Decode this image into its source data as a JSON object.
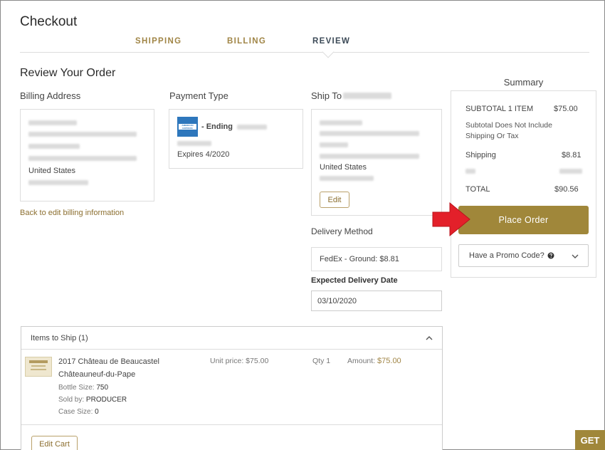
{
  "page": {
    "title": "Checkout"
  },
  "steps": [
    {
      "label": "SHIPPING"
    },
    {
      "label": "BILLING"
    },
    {
      "label": "REVIEW"
    }
  ],
  "review": {
    "heading": "Review Your Order",
    "billing": {
      "heading": "Billing Address",
      "country": "United States",
      "back_link": "Back to edit billing information"
    },
    "payment": {
      "heading": "Payment Type",
      "card_brand": "AMERICAN EXPRESS",
      "ending_label": "- Ending",
      "expires": "Expires 4/2020"
    },
    "ship_to": {
      "heading": "Ship To",
      "country": "United States",
      "edit_label": "Edit"
    },
    "delivery": {
      "heading": "Delivery Method",
      "method": "FedEx - Ground: $8.81",
      "date_heading": "Expected Delivery Date",
      "date_value": "03/10/2020"
    }
  },
  "items": {
    "header": "Items to Ship (1)",
    "rows": [
      {
        "name_line1": "2017 Château de Beaucastel",
        "name_line2": "Châteauneuf-du-Pape",
        "bottle_label": "Bottle Size:",
        "bottle_value": "750",
        "sold_label": "Sold by:",
        "sold_value": "PRODUCER",
        "case_label": "Case Size:",
        "case_value": "0",
        "unit_price": "Unit price: $75.00",
        "qty": "Qty 1",
        "amount_label": "Amount:",
        "amount_value": "$75.00"
      }
    ],
    "edit_cart": "Edit Cart"
  },
  "summary": {
    "heading": "Summary",
    "subtotal_label": "SUBTOTAL 1 ITEM",
    "subtotal_value": "$75.00",
    "note": "Subtotal Does Not Include Shipping Or Tax",
    "shipping_label": "Shipping",
    "shipping_value": "$8.81",
    "total_label": "TOTAL",
    "total_value": "$90.56",
    "place_order": "Place Order",
    "promo": "Have a Promo Code?"
  },
  "floating": {
    "get_label": "GET"
  },
  "colors": {
    "accent": "#a0873a",
    "annotation_arrow": "#e3202a"
  }
}
